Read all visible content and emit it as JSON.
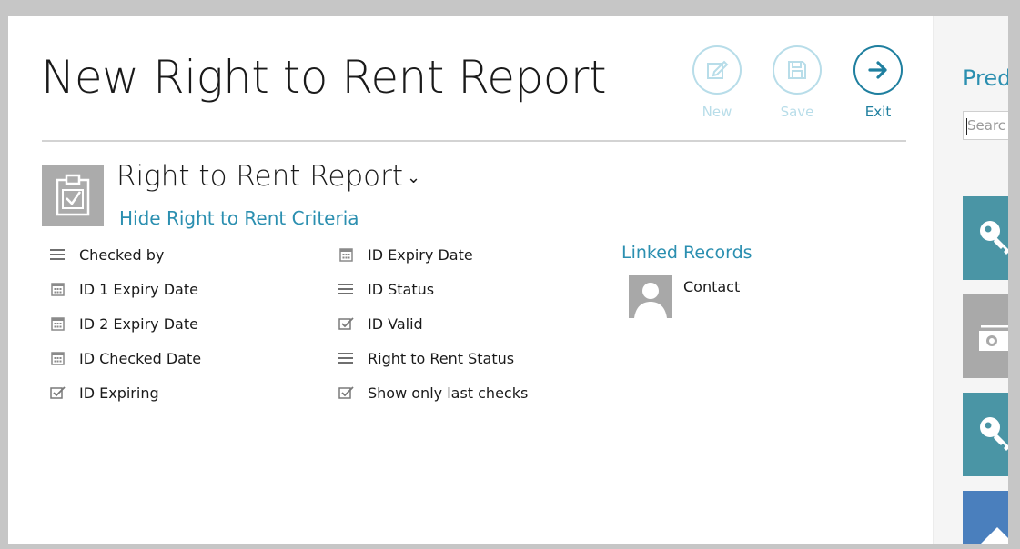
{
  "header": {
    "title": "New Right to Rent Report",
    "toolbar": {
      "new_label": "New",
      "save_label": "Save",
      "exit_label": "Exit"
    }
  },
  "report": {
    "name": "Right to Rent Report",
    "criteria_link": "Hide Right to Rent Criteria"
  },
  "criteria": {
    "column1": [
      {
        "label": "Checked by",
        "icon": "list-icon"
      },
      {
        "label": "ID 1 Expiry Date",
        "icon": "calendar-icon"
      },
      {
        "label": "ID 2 Expiry Date",
        "icon": "calendar-icon"
      },
      {
        "label": "ID Checked Date",
        "icon": "calendar-icon"
      },
      {
        "label": "ID Expiring",
        "icon": "checkbox-icon"
      }
    ],
    "column2": [
      {
        "label": "ID Expiry Date",
        "icon": "calendar-icon"
      },
      {
        "label": "ID Status",
        "icon": "list-icon"
      },
      {
        "label": "ID Valid",
        "icon": "checkbox-icon"
      },
      {
        "label": "Right to Rent Status",
        "icon": "list-icon"
      },
      {
        "label": "Show only last checks",
        "icon": "checkbox-icon"
      }
    ]
  },
  "linked": {
    "title": "Linked Records",
    "items": [
      {
        "label": "Contact",
        "icon": "person-icon"
      }
    ]
  },
  "right_pane": {
    "title": "Pred",
    "search_placeholder": "Searc",
    "tiles": [
      {
        "icon": "key-icon",
        "color": "#4a95a5"
      },
      {
        "icon": "money-icon",
        "color": "#a9a9a9"
      },
      {
        "icon": "key-icon",
        "color": "#4a95a5"
      },
      {
        "icon": "house-icon",
        "color": "#4a7fbd"
      }
    ]
  },
  "colors": {
    "accent": "#2b8fb0",
    "exit": "#1f7f9f",
    "disabled": "#b8dde9"
  }
}
